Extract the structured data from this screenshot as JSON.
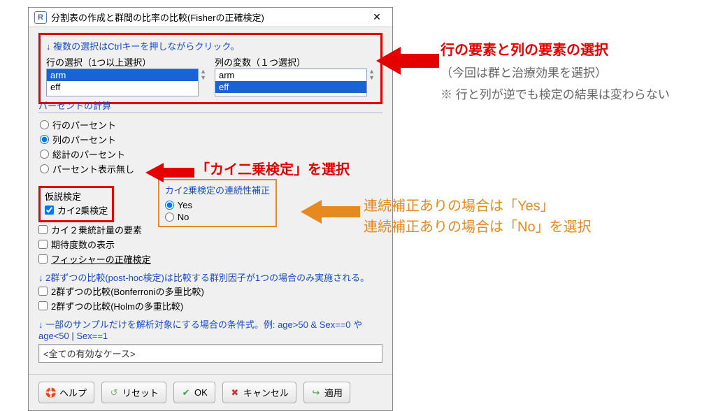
{
  "dialog": {
    "title": "分割表の作成と群間の比率の比較(Fisherの正確検定)",
    "close": "✕"
  },
  "top_hint": "↓  複数の選択はCtrlキーを押しながらクリック。",
  "row_sel": {
    "label": "行の選択（1つ以上選択）",
    "items": [
      "arm",
      "eff"
    ],
    "selected": "arm"
  },
  "col_sel": {
    "label": "列の変数（１つ選択）",
    "items": [
      "arm",
      "eff"
    ],
    "selected": "eff"
  },
  "percent": {
    "head": "パーセントの計算",
    "opts": [
      "行のパーセント",
      "列のパーセント",
      "総計のパーセント",
      "パーセント表示無し"
    ],
    "selected": 1
  },
  "hypo": {
    "head": "仮説検定",
    "chi2": "カイ2乗検定",
    "chi2comp": "カイ２乗統計量の要素",
    "expected": "期待度数の表示",
    "fisher": "フィッシャーの正確検定"
  },
  "cc": {
    "label": "カイ2乗検定の連続性補正",
    "yes": "Yes",
    "no": "No"
  },
  "posthoc_note": "↓ 2群ずつの比較(post-hoc検定)は比較する群別因子が1つの場合のみ実施される。",
  "ph1": "2群ずつの比較(Bonferroniの多重比較)",
  "ph2": "2群ずつの比較(Holmの多重比較)",
  "subset_note": "↓ 一部のサンプルだけを解析対象にする場合の条件式。例: age>50 & Sex==0 や age<50 | Sex==1",
  "subset_input": "<全ての有効なケース>",
  "buttons": {
    "help": "ヘルプ",
    "reset": "リセット",
    "ok": "OK",
    "cancel": "キャンセル",
    "apply": "適用"
  },
  "annot": {
    "a1a": "行の要素と列の要素の選択",
    "a1b": "（今回は群と治療効果を選択）",
    "a1c": "※ 行と列が逆でも検定の結果は変わらない",
    "a2": "「カイ二乗検定」を選択",
    "a3a": "連続補正ありの場合は「Yes」",
    "a3b": "連続補正ありの場合は「No」を選択"
  }
}
